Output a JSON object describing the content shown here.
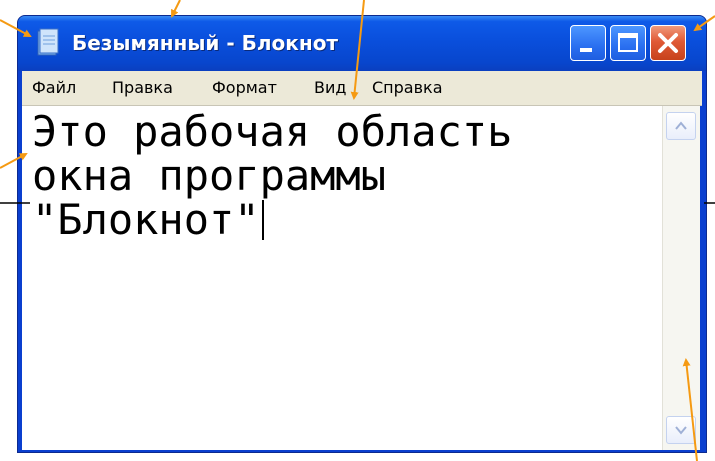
{
  "window": {
    "title": "Безымянный - Блокнот",
    "colors": {
      "titlebar": "#0a4fdc",
      "menubar": "#ece9d8",
      "close_button": "#e05a36",
      "annotation_arrow": "#f59a12"
    }
  },
  "icons": {
    "app": "notepad-icon",
    "minimize": "minimize-icon",
    "maximize": "maximize-icon",
    "close": "close-icon",
    "scroll_up": "chevron-up-icon",
    "scroll_down": "chevron-down-icon"
  },
  "menu": {
    "items": [
      {
        "label": "Файл"
      },
      {
        "label": "Правка"
      },
      {
        "label": "Формат"
      },
      {
        "label": "Вид"
      },
      {
        "label": "Справка"
      }
    ]
  },
  "editor": {
    "text": "Это рабочая область\nокна программы\n\"Блокнот\""
  }
}
